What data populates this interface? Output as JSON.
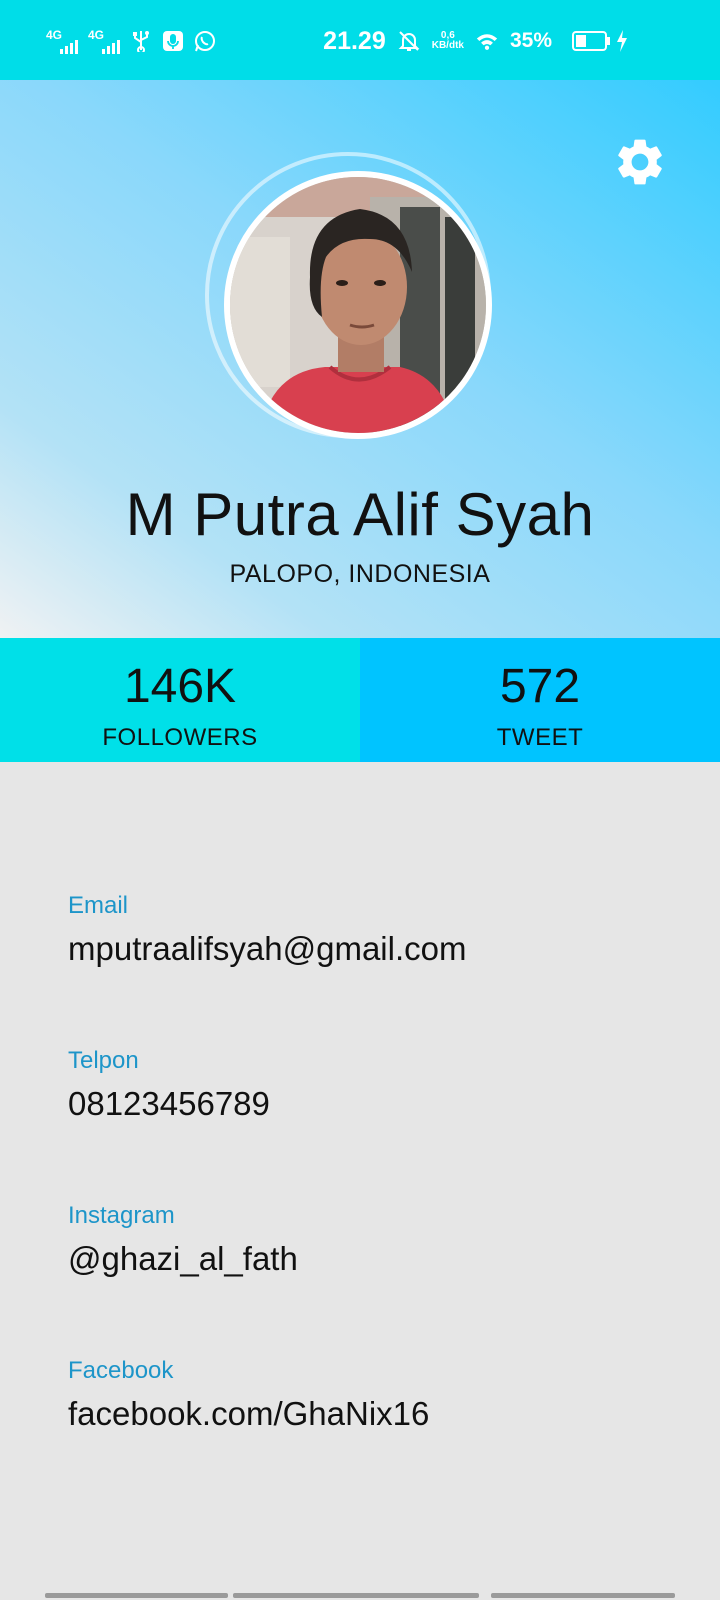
{
  "status_bar": {
    "signal1_label": "4G",
    "signal2_label": "4G",
    "time": "21.29",
    "speed_value": "0,6",
    "speed_unit": "KB/dtk",
    "battery_percent": "35%",
    "battery_level": 0.35,
    "icons": [
      "signal-icon",
      "signal-icon",
      "usb-icon",
      "mic-notification-icon",
      "whatsapp-icon",
      "mute-icon",
      "wifi-icon",
      "battery-icon",
      "charging-icon"
    ]
  },
  "profile": {
    "name": "M Putra Alif Syah",
    "location": "PALOPO, INDONESIA"
  },
  "stats": {
    "followers_value": "146K",
    "followers_label": "FOLLOWERS",
    "tweet_value": "572",
    "tweet_label": "TWEET"
  },
  "info": [
    {
      "label": "Email",
      "value": "mputraalifsyah@gmail.com"
    },
    {
      "label": "Telpon",
      "value": "08123456789"
    },
    {
      "label": "Instagram",
      "value": "@ghazi_al_fath"
    },
    {
      "label": "Facebook",
      "value": "facebook.com/GhaNix16"
    }
  ],
  "colors": {
    "status_bar": "#00dde8",
    "followers_bg": "#00e0e8",
    "tweet_bg": "#00c4ff",
    "label_accent": "#1d95c9",
    "page_bg": "#e6e6e6"
  }
}
